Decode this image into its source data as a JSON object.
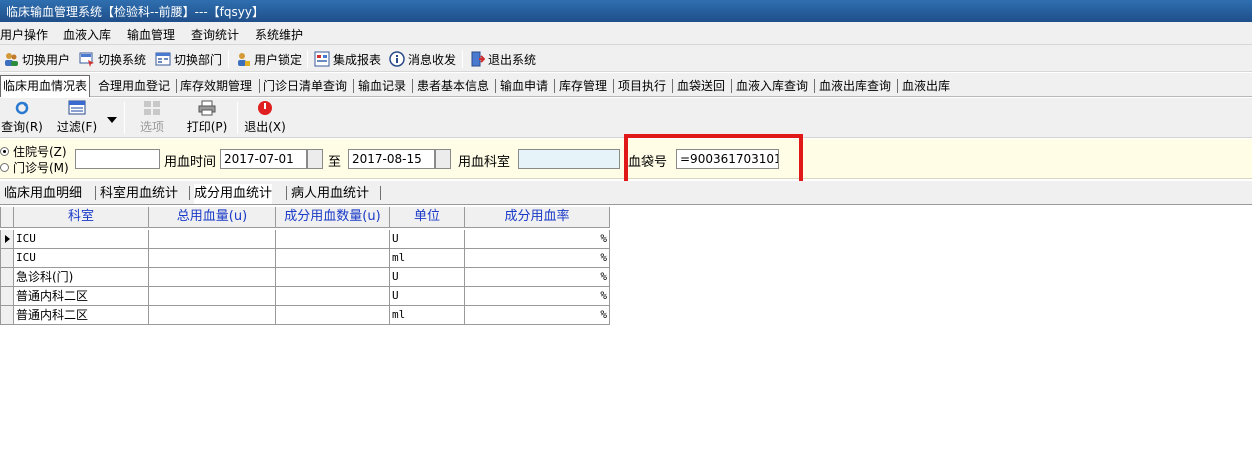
{
  "window": {
    "title": "临床输血管理系统【检验科--前腰】---【fqsyy】"
  },
  "menu": [
    "用户操作",
    "血液入库",
    "输血管理",
    "查询统计",
    "系统维护"
  ],
  "toolbar": {
    "switch_user": "切换用户",
    "switch_system": "切换系统",
    "switch_dept": "切换部门",
    "lock_user": "用户锁定",
    "report": "集成报表",
    "messages": "消息收发",
    "exit_system": "退出系统"
  },
  "module_tabs": [
    "临床用血情况表",
    "合理用血登记",
    "库存效期管理",
    "门诊日清单查询",
    "输血记录",
    "患者基本信息",
    "输血申请",
    "库存管理",
    "项目执行",
    "血袋送回",
    "血液入库查询",
    "血液出库查询",
    "血液出库"
  ],
  "actions": {
    "query": "查询(R)",
    "filter": "过滤(F)",
    "options": "选项",
    "print": "打印(P)",
    "exit": "退出(X)"
  },
  "filter": {
    "inpatient_label": "住院号(Z)",
    "outpatient_label": "门诊号(M)",
    "patient_no_value": "",
    "time_label": "用血时间",
    "date_from": "2017-07-01",
    "to_label": "至",
    "date_to": "2017-08-15",
    "dept_label": "用血科室",
    "dept_value": "",
    "bag_label": "血袋号",
    "bag_value": "=900361703101"
  },
  "sub_tabs": [
    "临床用血明细",
    "科室用血统计",
    "成分用血统计",
    "病人用血统计"
  ],
  "table": {
    "columns": [
      "科室",
      "总用血量(u)",
      "成分用血数量(u)",
      "单位",
      "成分用血率"
    ],
    "rows": [
      [
        "ICU",
        "",
        "",
        "U",
        "%"
      ],
      [
        "ICU",
        "",
        "",
        "ml",
        "%"
      ],
      [
        "急诊科(门)",
        "",
        "",
        "U",
        "%"
      ],
      [
        "普通内科二区",
        "",
        "",
        "U",
        "%"
      ],
      [
        "普通内科二区",
        "",
        "",
        "ml",
        "%"
      ]
    ]
  }
}
